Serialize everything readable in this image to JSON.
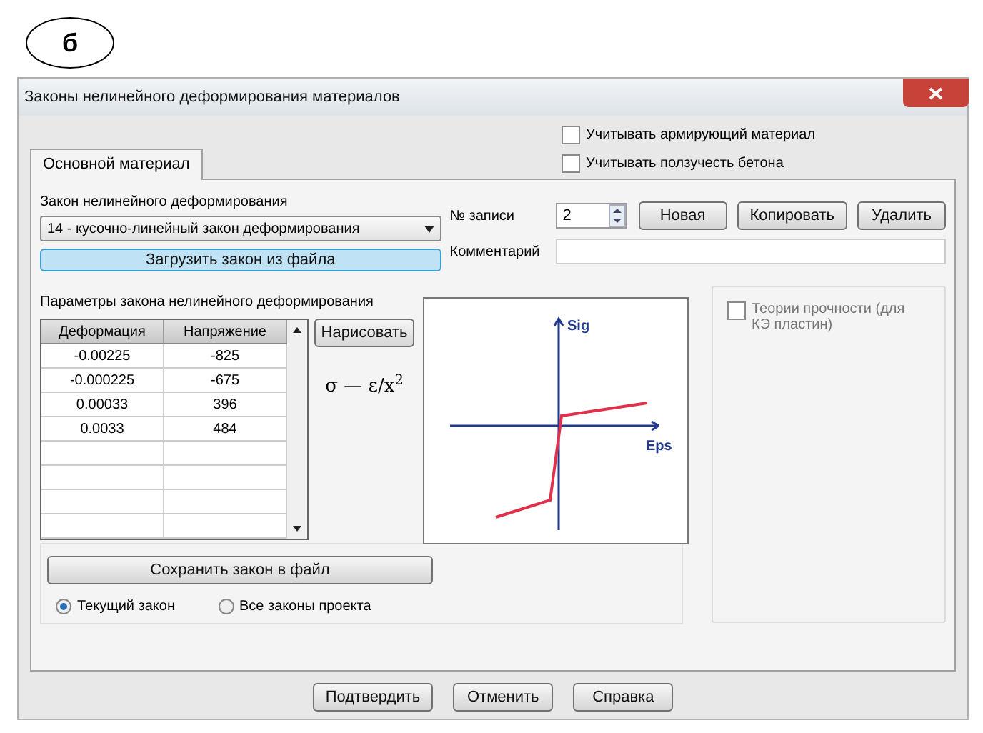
{
  "figure_label": "б",
  "window": {
    "title": "Законы нелинейного деформирования материалов"
  },
  "options": [
    {
      "label": "Учитывать армирующий материал",
      "checked": false
    },
    {
      "label": "Учитывать ползучесть бетона",
      "checked": false
    }
  ],
  "tabs": [
    {
      "label": "Основной материал",
      "selected": true
    }
  ],
  "law": {
    "label": "Закон нелинейного деформирования",
    "value": "14 - кусочно-линейный закон деформирования",
    "load_button": "Загрузить закон из файла"
  },
  "record": {
    "label": "№ записи",
    "value": "2",
    "buttons": [
      "Новая",
      "Копировать",
      "Удалить"
    ]
  },
  "comment": {
    "label": "Комментарий"
  },
  "params": {
    "title": "Параметры закона нелинейного деформирования",
    "columns": [
      "Деформация",
      "Напряжение"
    ],
    "rows": [
      [
        "-0.00225",
        "-825"
      ],
      [
        "-0.000225",
        "-675"
      ],
      [
        "0.00033",
        "396"
      ],
      [
        "0.0033",
        "484"
      ]
    ],
    "draw_button": "Нарисовать",
    "formula": "σ — ε/x$^{2}$"
  },
  "diagram": {
    "y_label": "Sig",
    "x_label": "Eps"
  },
  "strength": {
    "label": "Теории прочности (для КЭ пластин)",
    "checked": false
  },
  "save_button": "Сохранить закон в файл",
  "scope": [
    {
      "label": "Текущий закон",
      "selected": true
    },
    {
      "label": "Все законы проекта",
      "selected": false
    }
  ],
  "buttons": [
    "Подтвердить",
    "Отменить",
    "Справка"
  ]
}
